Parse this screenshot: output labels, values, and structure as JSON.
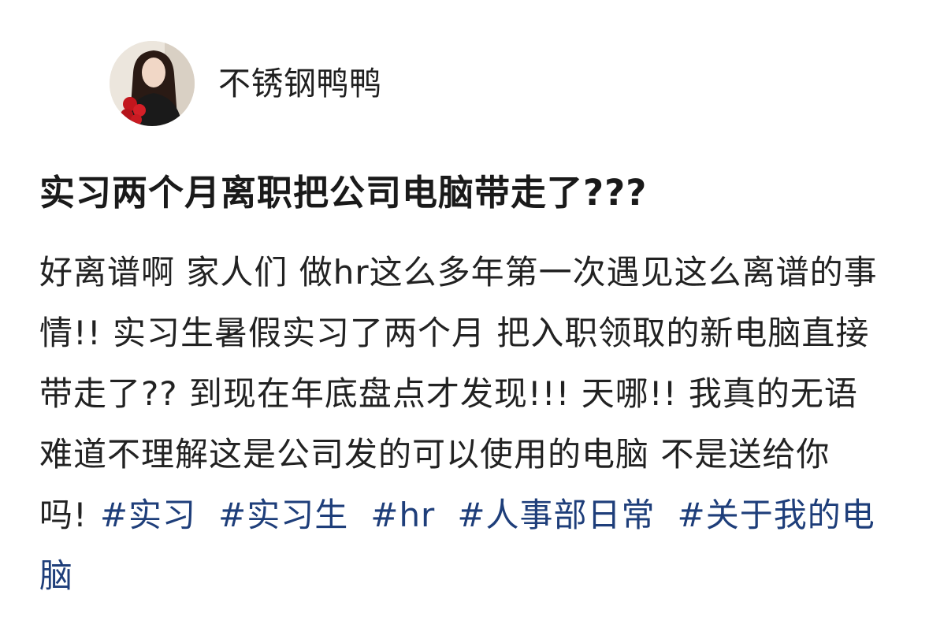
{
  "author": {
    "name": "不锈钢鸭鸭"
  },
  "post": {
    "title": "实习两个月离职把公司电脑带走了???",
    "body": "好离谱啊 家人们 做hr这么多年第一次遇见这么离谱的事情!! 实习生暑假实习了两个月 把入职领取的新电脑直接带走了?? 到现在年底盘点才发现!!! 天哪!! 我真的无语 难道不理解这是公司发的可以使用的电脑 不是送给你吗!",
    "tags": [
      "#实习",
      "#实习生",
      "#hr",
      "#人事部日常",
      "#关于我的电脑"
    ]
  },
  "colors": {
    "tag": "#1e3e7a",
    "text": "#222222",
    "background": "#ffffff"
  }
}
